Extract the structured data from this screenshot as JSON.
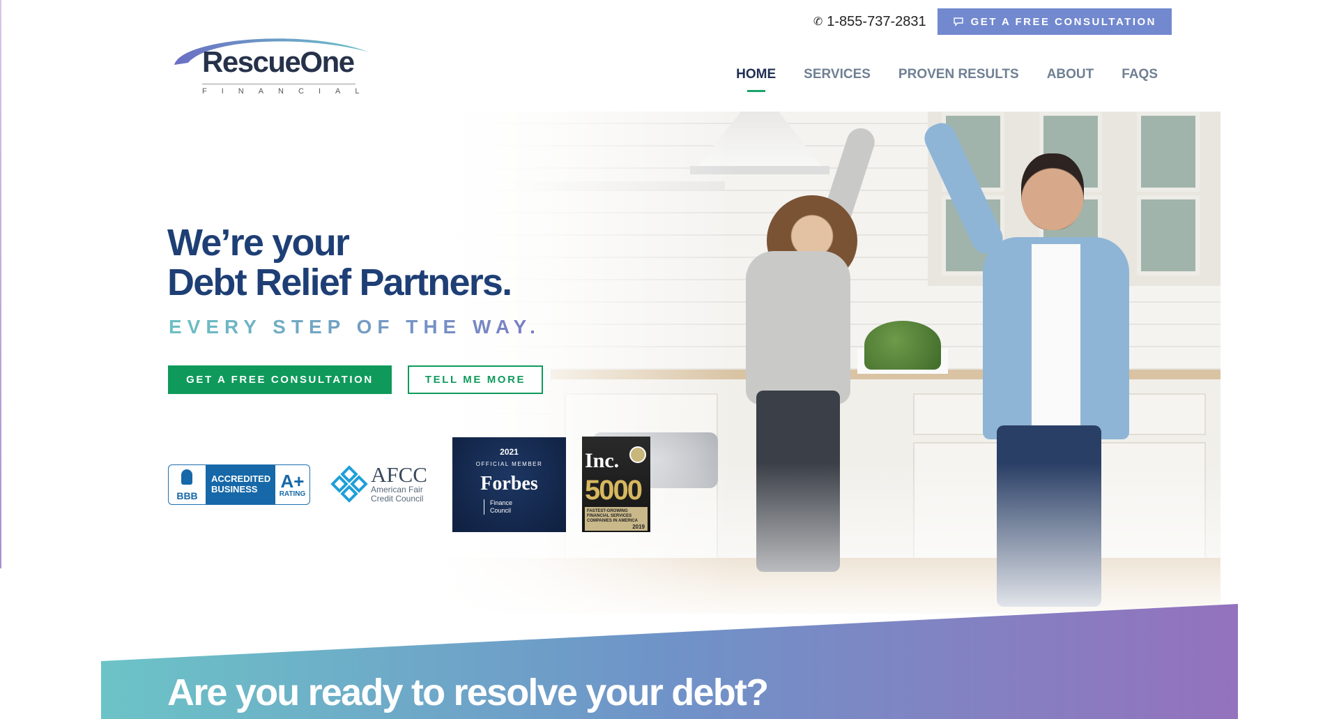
{
  "header": {
    "phone": "1-855-737-2831",
    "phone_icon": "phone-icon",
    "top_cta": "GET A FREE CONSULTATION",
    "top_cta_icon": "chat-bubble-icon",
    "logo": {
      "name": "RescueOne",
      "subtitle": "FINANCIAL"
    },
    "nav": [
      {
        "label": "HOME",
        "active": true
      },
      {
        "label": "SERVICES",
        "active": false
      },
      {
        "label": "PROVEN RESULTS",
        "active": false
      },
      {
        "label": "ABOUT",
        "active": false
      },
      {
        "label": "FAQS",
        "active": false
      }
    ]
  },
  "hero": {
    "headline_line1": "We’re your",
    "headline_line2": "Debt Relief Partners.",
    "tagline": "EVERY STEP OF THE WAY.",
    "primary_button": "GET A FREE CONSULTATION",
    "secondary_button": "TELL ME MORE"
  },
  "badges": {
    "bbb": {
      "seal": "BBB",
      "line1": "ACCREDITED",
      "line2": "BUSINESS",
      "grade": "A+",
      "grade_label": "RATING"
    },
    "afcc": {
      "title": "AFCC",
      "line1": "American Fair",
      "line2": "Credit Council"
    },
    "forbes": {
      "year": "2021",
      "member": "OFFICIAL MEMBER",
      "name": "Forbes",
      "line1": "Finance",
      "line2": "Council"
    },
    "inc": {
      "word": "Inc.",
      "number": "5000",
      "caption": "FASTEST-GROWING FINANCIAL SERVICES COMPANIES IN AMERICA",
      "year": "2019"
    }
  },
  "band": {
    "title": "Are you ready to resolve your debt?"
  },
  "colors": {
    "primary_green": "#0f9a5b",
    "navy": "#1e3f75",
    "cta_blue": "#7289cf",
    "band_start": "#6cc3c7",
    "band_end": "#9472bd"
  }
}
